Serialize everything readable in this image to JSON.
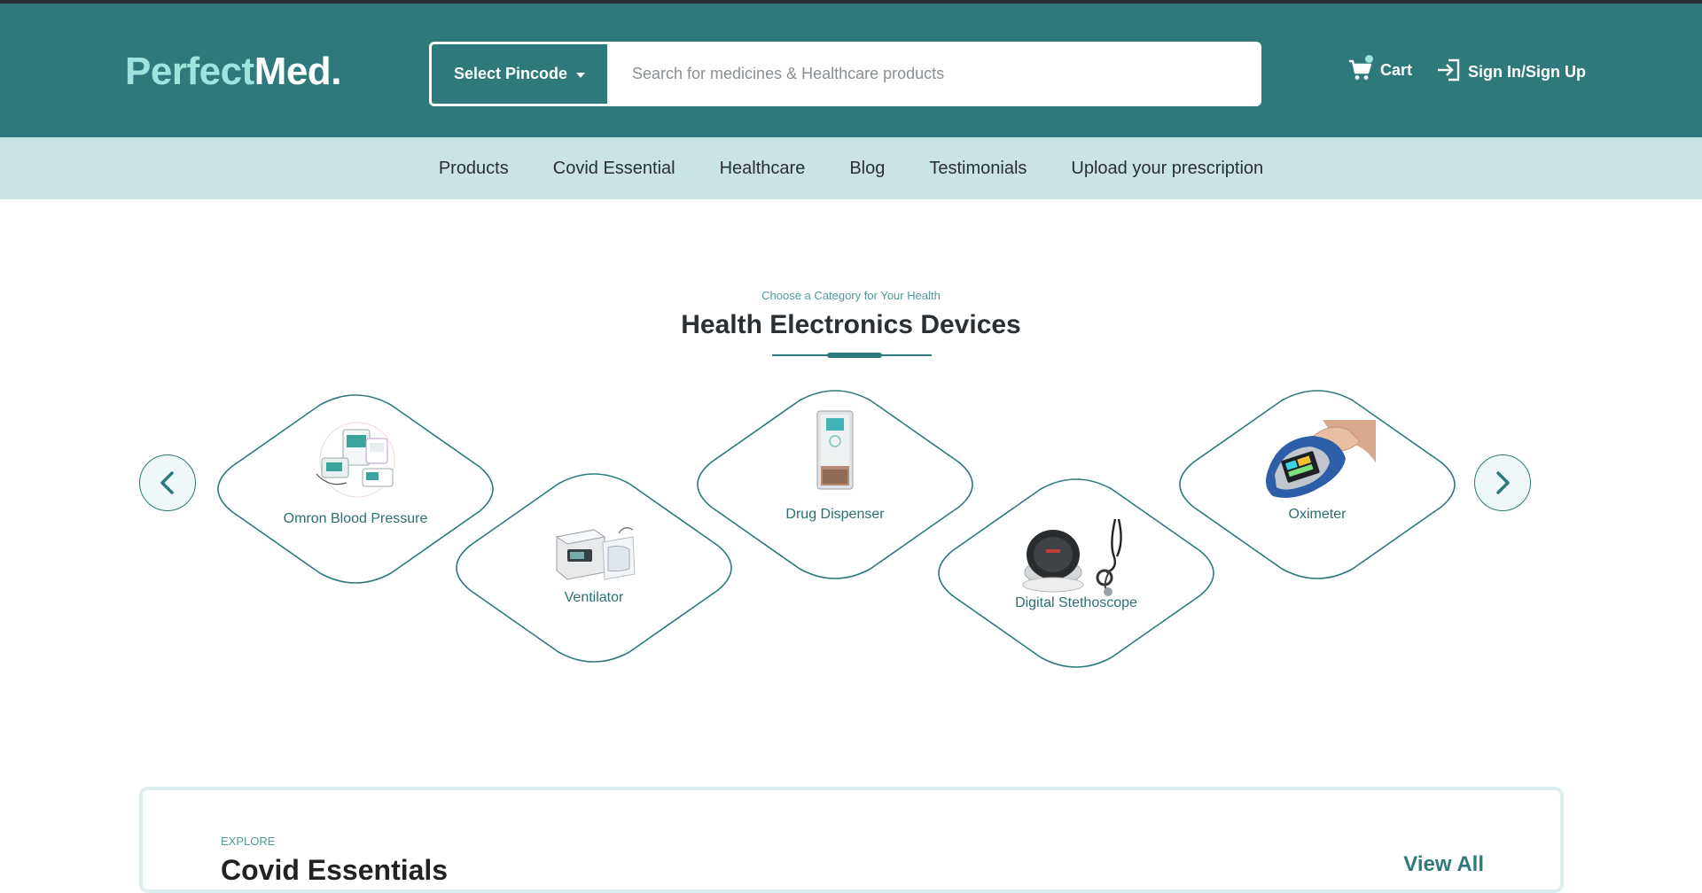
{
  "header": {
    "logo_part1": "Perfect",
    "logo_part2": "Med.",
    "pincode_label": "Select Pincode",
    "search_placeholder": "Search for medicines & Healthcare products",
    "cart_label": "Cart",
    "signin_label": "Sign In/Sign Up"
  },
  "nav": {
    "items": [
      {
        "label": "Products"
      },
      {
        "label": "Covid Essential"
      },
      {
        "label": "Healthcare"
      },
      {
        "label": "Blog"
      },
      {
        "label": "Testimonials"
      },
      {
        "label": "Upload your prescription"
      }
    ]
  },
  "categories": {
    "subtitle": "Choose a Category for Your Health",
    "title": "Health Electronics Devices",
    "items": [
      {
        "label": "Omron Blood Pressure",
        "icon": "blood-pressure-monitor-icon"
      },
      {
        "label": "Ventilator",
        "icon": "ventilator-icon"
      },
      {
        "label": "Drug Dispenser",
        "icon": "drug-dispenser-icon"
      },
      {
        "label": "Digital Stethoscope",
        "icon": "stethoscope-icon"
      },
      {
        "label": "Oximeter",
        "icon": "oximeter-icon"
      }
    ]
  },
  "explore": {
    "tag": "EXPLORE",
    "title": "Covid Essentials",
    "view_all": "View All"
  },
  "colors": {
    "primary": "#2d797c",
    "accent": "#9fe3df",
    "nav_bg": "#c9e4e3"
  }
}
